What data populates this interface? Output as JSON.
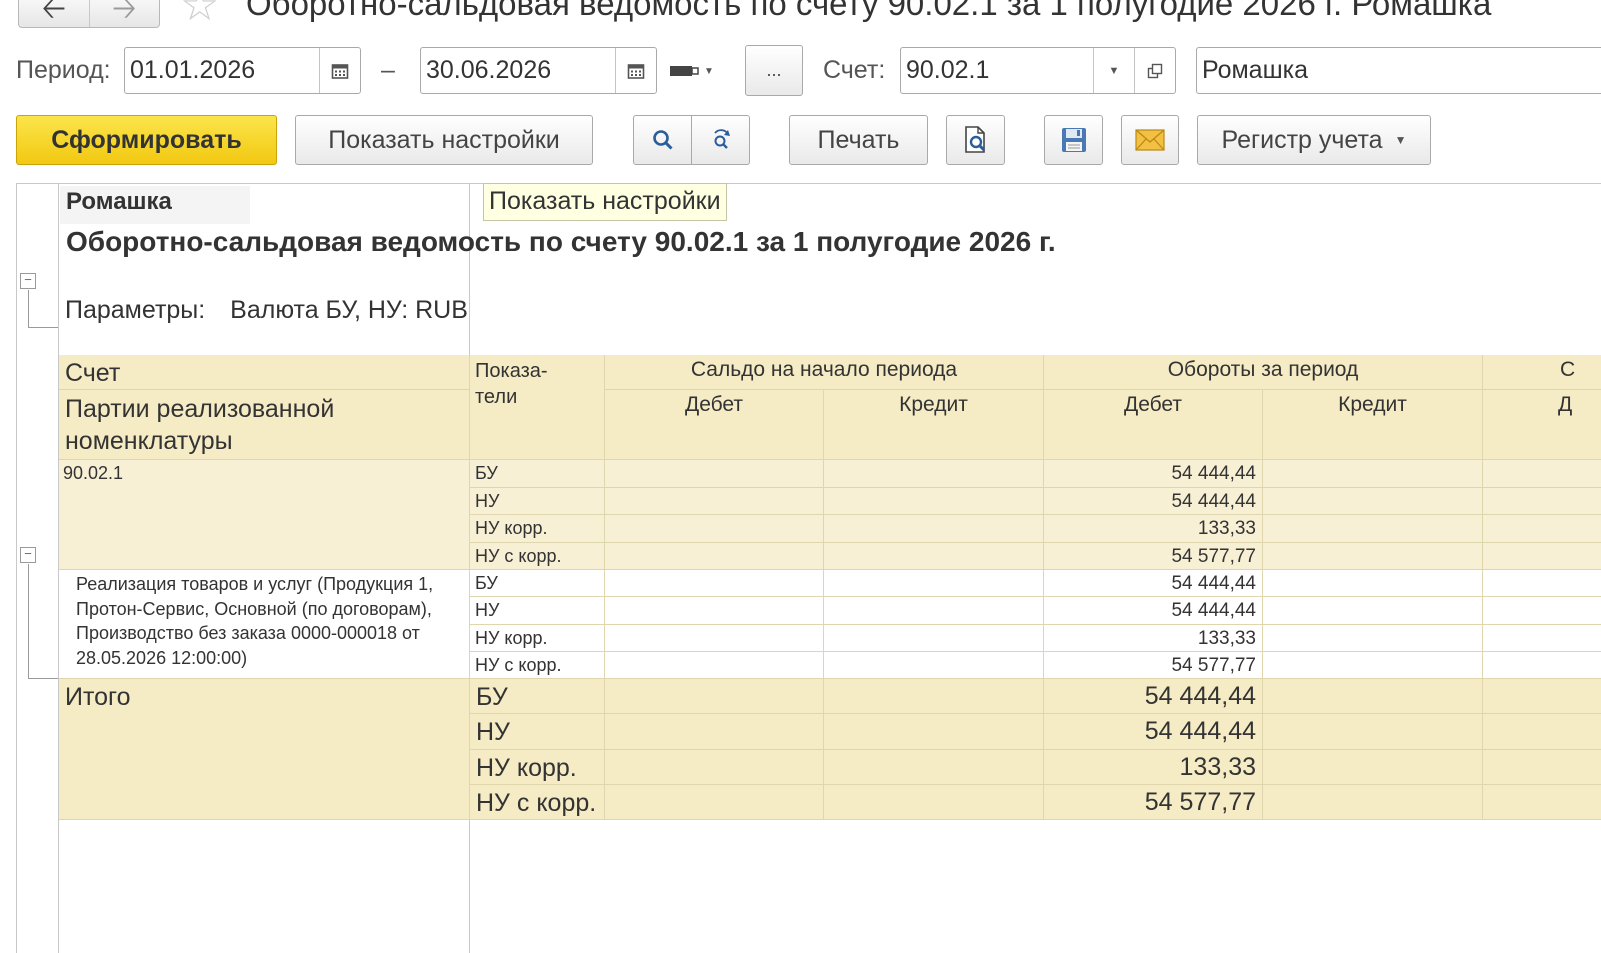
{
  "window": {
    "title": "Оборотно-сальдовая ведомость по счету 90.02.1 за 1 полугодие 2026 г. Ромашка",
    "back_icon": "arrow-left-icon",
    "forward_icon": "arrow-right-icon",
    "favorite_icon": "star-icon"
  },
  "filters": {
    "period_label": "Период:",
    "date_from": "01.01.2026",
    "dash": "–",
    "date_to": "30.06.2026",
    "more_label": "...",
    "account_label": "Счет:",
    "account_value": "90.02.1",
    "organization": "Ромашка"
  },
  "toolbar": {
    "generate": "Сформировать",
    "show_settings": "Показать настройки",
    "print": "Печать",
    "register": "Регистр учета",
    "tooltip": "Показать настройки"
  },
  "report": {
    "organization": "Ромашка",
    "title": "Оборотно-сальдовая ведомость по счету 90.02.1 за 1 полугодие 2026 г.",
    "params_label": "Параметры:",
    "params_value": "Валюта БУ, НУ: RUB",
    "header": {
      "account": "Счет",
      "batches": "Партии реализованной номенклатуры",
      "indicators": "Показа-\nтели",
      "opening_balance": "Сальдо на начало периода",
      "turnover": "Обороты за период",
      "closing_partial": "С",
      "debit": "Дебет",
      "credit": "Кредит",
      "debit_partial": "Д"
    },
    "rows": [
      {
        "label": "90.02.1",
        "indicators": [
          "БУ",
          "НУ",
          "НУ корр.",
          "НУ с корр."
        ],
        "turnover_debit": [
          "54 444,44",
          "54 444,44",
          "133,33",
          "54 577,77"
        ]
      },
      {
        "label": "Реализация товаров и услуг (Продукция 1, Протон-Сервис, Основной (по договорам), Производство без заказа 0000-000018 от 28.05.2026 12:00:00)",
        "indicators": [
          "БУ",
          "НУ",
          "НУ корр.",
          "НУ с корр."
        ],
        "turnover_debit": [
          "54 444,44",
          "54 444,44",
          "133,33",
          "54 577,77"
        ]
      }
    ],
    "total": {
      "label": "Итого",
      "indicators": [
        "БУ",
        "НУ",
        "НУ корр.",
        "НУ с корр."
      ],
      "turnover_debit": [
        "54 444,44",
        "54 444,44",
        "133,33",
        "54 577,77"
      ]
    }
  }
}
